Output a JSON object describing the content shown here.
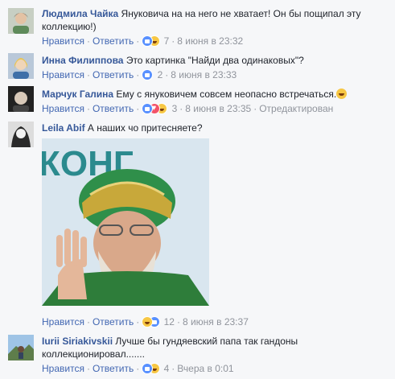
{
  "ui": {
    "like_label": "Нравится",
    "reply_label": "Ответить",
    "dot": "·"
  },
  "comments": [
    {
      "author": "Людмила Чайка",
      "text": "Януковича на на него не хватает! Он бы пощипал эту коллекцию!)",
      "reactions": [
        "like",
        "haha"
      ],
      "count": "7",
      "time": "8 июня в 23:32"
    },
    {
      "author": "Инна Филиппова",
      "text": "Это картинка \"Найди два одинаковых\"?",
      "reactions": [
        "like"
      ],
      "count": "2",
      "time": "8 июня в 23:33"
    },
    {
      "author": "Марчук Галина",
      "text": "Ему с януковичем совсем неопасно встречаться.",
      "trailing_emoji": "laugh-emoji",
      "reactions": [
        "like",
        "love",
        "haha"
      ],
      "count": "3",
      "time": "8 июня в 23:35",
      "edited": "Отредактирован"
    },
    {
      "author": "Leila Abif",
      "text": "А наших чо притесняете?",
      "photo_caption_visible": "КОНГ",
      "reactions": [
        "haha",
        "like"
      ],
      "count": "12",
      "time": "8 июня в 23:37"
    },
    {
      "author": "Iurii Siriakivskii",
      "text": "Лучше бы гундяевский папа так гандоны коллекционировал.......",
      "reactions": [
        "like",
        "haha"
      ],
      "count": "4",
      "time": "Вчера в 0:01"
    }
  ],
  "colors": {
    "author": "#365899",
    "link": "#4267b2",
    "meta": "#90949c",
    "background": "#f6f7f9"
  }
}
